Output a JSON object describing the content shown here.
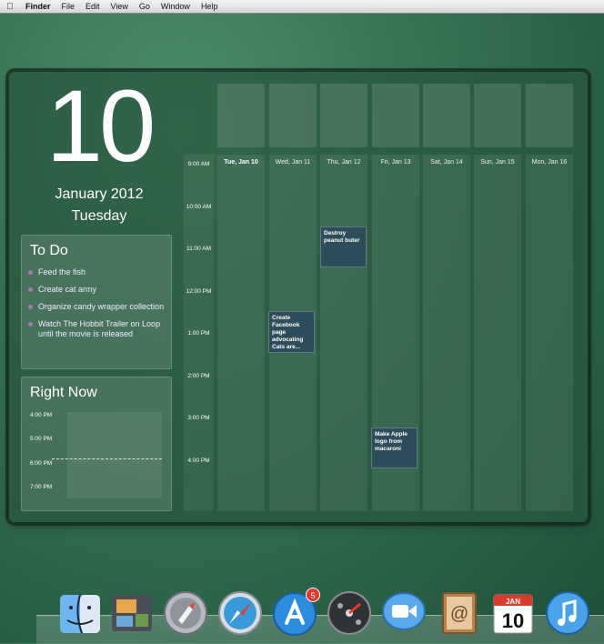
{
  "menubar": {
    "items": [
      "Finder",
      "File",
      "Edit",
      "View",
      "Go",
      "Window",
      "Help"
    ]
  },
  "date": {
    "day": "10",
    "month_year": "January 2012",
    "weekday": "Tuesday"
  },
  "todo": {
    "title": "To Do",
    "items": [
      "Feed the fish",
      "Create cat army",
      "Organize candy wrapper collection",
      "Watch The Hobbit Trailer on Loop until the movie is released"
    ]
  },
  "right_now": {
    "title": "Right Now",
    "times": [
      "4:00 PM",
      "5:00 PM",
      "6:00 PM",
      "7:00 PM"
    ]
  },
  "calendar": {
    "hours": [
      "9:00 AM",
      "10:00 AM",
      "11:00 AM",
      "12:00 PM",
      "1:00 PM",
      "2:00 PM",
      "3:00 PM",
      "4:00 PM"
    ],
    "days": [
      "Tue, Jan 10",
      "Wed, Jan 11",
      "Thu, Jan 12",
      "Fri, Jan 13",
      "Sat, Jan 14",
      "Sun, Jan 15",
      "Mon, Jan 16"
    ],
    "events": [
      {
        "day": "Thu, Jan 12",
        "start": "10:15 AM",
        "text": "Destroy peanut buter"
      },
      {
        "day": "Wed, Jan 11",
        "start": "12:15 PM",
        "text": "Create Facebook page advocating Cats are..."
      },
      {
        "day": "Fri, Jan 13",
        "start": "3:00 PM",
        "text": "Make Apple logo from macaroni"
      }
    ]
  },
  "dock": {
    "icons": [
      "finder-icon",
      "iphoto-icon",
      "launchpad-icon",
      "safari-icon",
      "app-store-icon",
      "dashboard-icon",
      "facetime-icon",
      "address-book-icon",
      "ical-icon",
      "itunes-icon"
    ],
    "app_store_badge": "5",
    "ical_month": "JAN",
    "ical_day": "10"
  }
}
